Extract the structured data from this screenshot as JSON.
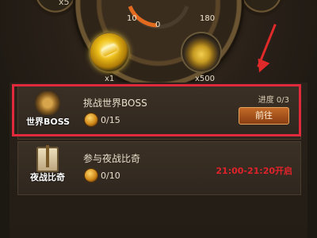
{
  "top": {
    "x5": "x5",
    "gauge": {
      "left": "10",
      "mid": "0",
      "right": "180"
    },
    "rewards": [
      {
        "icon": "gold-bar-icon",
        "count": "x1"
      },
      {
        "icon": "gold-bag-icon",
        "count": "x500"
      }
    ]
  },
  "tasks": [
    {
      "badge_label": "世界BOSS",
      "title": "挑战世界BOSS",
      "value": "0/15",
      "progress": "进度 0/3",
      "button": "前往"
    },
    {
      "badge_label": "夜战比奇",
      "title": "参与夜战比奇",
      "value": "0/10",
      "time": "21:00-21:20开启"
    }
  ],
  "colors": {
    "highlight": "#e0293a",
    "time_text": "#e0232b",
    "button": "#a8521e"
  }
}
